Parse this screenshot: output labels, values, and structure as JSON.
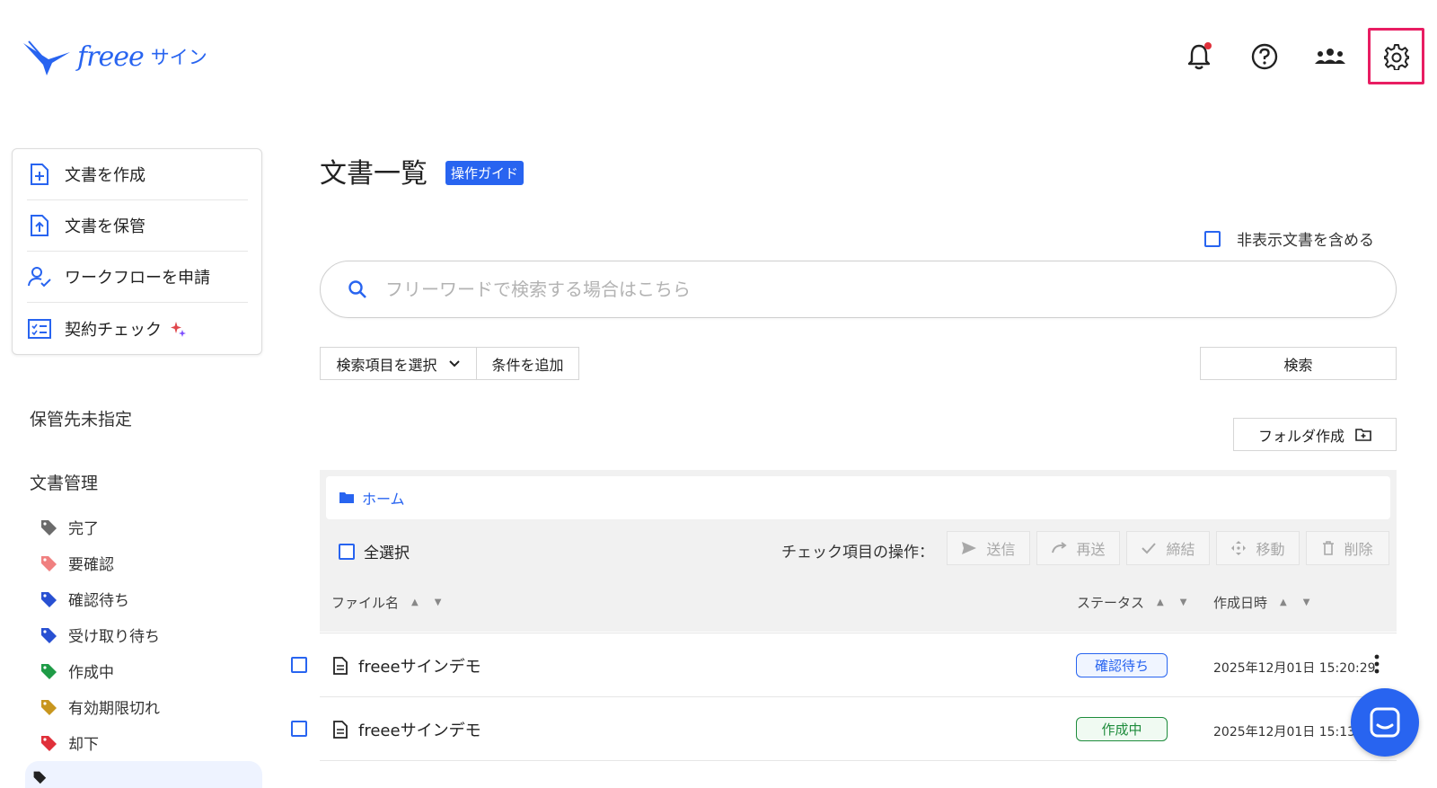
{
  "app": {
    "logo_text": "freee",
    "logo_sub": "サイン"
  },
  "header": {
    "icons": [
      "bell-icon",
      "help-icon",
      "users-icon",
      "gear-icon"
    ],
    "notification_dot_color": "#e0303a",
    "highlight_color": "#e81d62"
  },
  "sidebar": {
    "actions": [
      {
        "label": "文書を作成",
        "icon": "document-add-icon"
      },
      {
        "label": "文書を保管",
        "icon": "document-upload-icon"
      },
      {
        "label": "ワークフローを申請",
        "icon": "user-check-icon"
      },
      {
        "label": "契約チェック",
        "icon": "checklist-icon"
      }
    ],
    "unassigned_title": "保管先未指定",
    "doc_mgmt_title": "文書管理",
    "tags": [
      {
        "label": "完了",
        "color": "#6b6b6b"
      },
      {
        "label": "要確認",
        "color": "#f08080"
      },
      {
        "label": "確認待ち",
        "color": "#2850d2"
      },
      {
        "label": "受け取り待ち",
        "color": "#2850d2"
      },
      {
        "label": "作成中",
        "color": "#1e9b46"
      },
      {
        "label": "有効期限切れ",
        "color": "#c8961e"
      },
      {
        "label": "却下",
        "color": "#e0303a"
      }
    ]
  },
  "main": {
    "title": "文書一覧",
    "guide_label": "操作ガイド",
    "include_hidden_label": "非表示文書を含める",
    "search_placeholder": "フリーワードで検索する場合はこちら",
    "select_fields_label": "検索項目を選択",
    "add_condition_label": "条件を追加",
    "search_button": "検索",
    "create_folder_label": "フォルダ作成",
    "breadcrumb_home": "ホーム",
    "select_all_label": "全選択",
    "bulk_ops_label": "チェック項目の操作：",
    "bulk_ops": [
      {
        "label": "送信",
        "icon": "send-icon"
      },
      {
        "label": "再送",
        "icon": "redo-icon"
      },
      {
        "label": "締結",
        "icon": "check-icon"
      },
      {
        "label": "移動",
        "icon": "move-icon"
      },
      {
        "label": "削除",
        "icon": "trash-icon"
      }
    ],
    "columns": {
      "file_name": "ファイル名",
      "status": "ステータス",
      "created": "作成日時"
    },
    "rows": [
      {
        "name": "freeeサインデモ",
        "status": "確認待ち",
        "status_color": "#2864f0",
        "created": "2025年12月01日 15:20:29"
      },
      {
        "name": "freeeサインデモ",
        "status": "作成中",
        "status_color": "#1e8c3c",
        "created": "2025年12月01日 15:13:3"
      }
    ]
  }
}
